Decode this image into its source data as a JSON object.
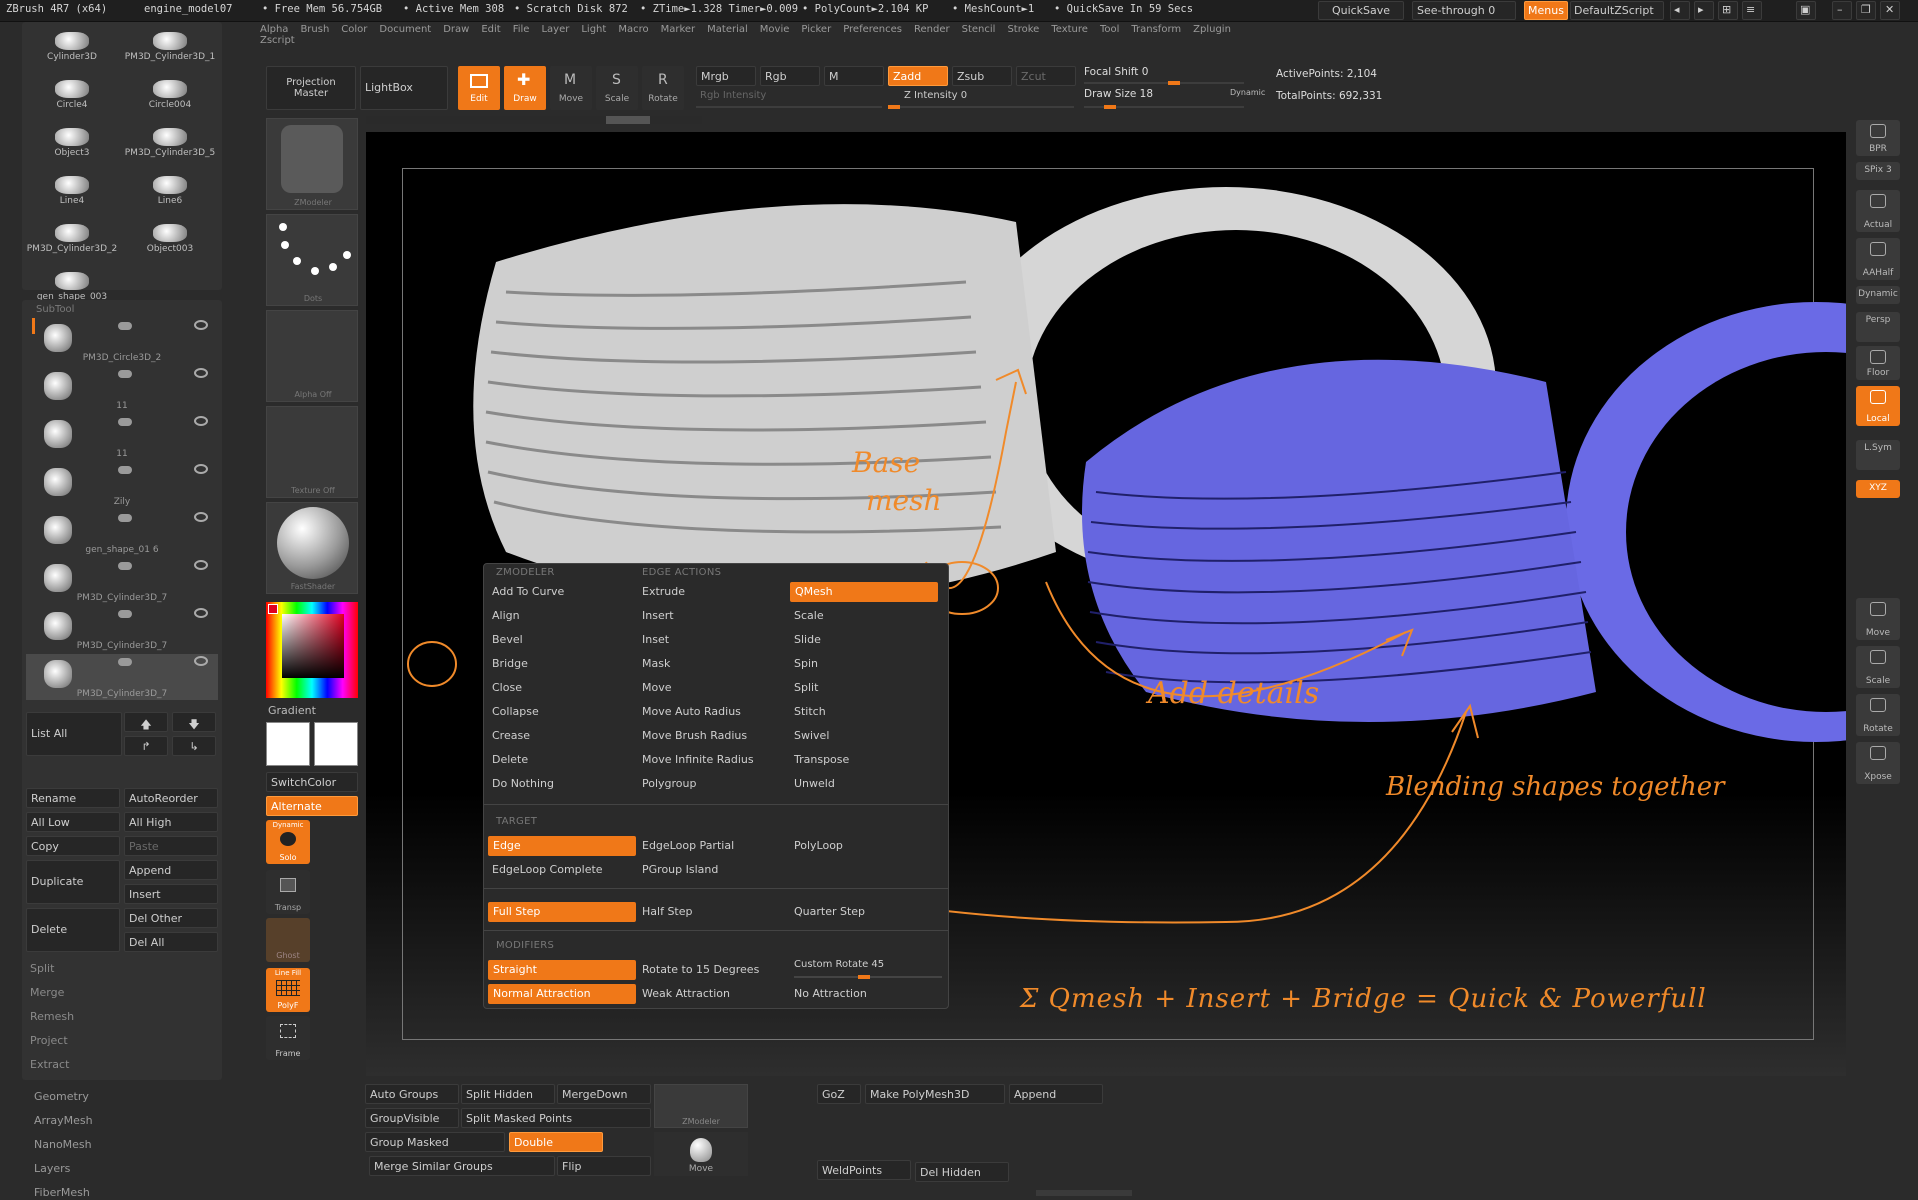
{
  "topbar": {
    "app": "ZBrush 4R7 (x64)",
    "doc": "engine_model07",
    "free_mem": "• Free Mem 56.754GB",
    "active_mem": "• Active Mem 308",
    "scratch": "• Scratch Disk 872",
    "ztime": "• ZTime►1.328 Timer►0.009",
    "polycount": "• PolyCount►2.104 KP",
    "meshcount": "• MeshCount►1",
    "quicksave_in": "• QuickSave In 59 Secs",
    "quicksave": "QuickSave",
    "see_through": "See-through   0",
    "menus": "Menus",
    "script": "DefaultZScript"
  },
  "menubar": [
    "Alpha",
    "Brush",
    "Color",
    "Document",
    "Draw",
    "Edit",
    "File",
    "Layer",
    "Light",
    "Macro",
    "Marker",
    "Material",
    "Movie",
    "Picker",
    "Preferences",
    "Render",
    "Stencil",
    "Stroke",
    "Texture",
    "Tool",
    "Transform",
    "Zplugin",
    "Zscript"
  ],
  "toolbar": {
    "projection_master": "Projection Master",
    "lightbox": "LightBox",
    "edit": "Edit",
    "draw": "Draw",
    "move": "Move",
    "scale": "Scale",
    "rotate": "Rotate",
    "mrgb": "Mrgb",
    "rgb": "Rgb",
    "m": "M",
    "zadd": "Zadd",
    "zsub": "Zsub",
    "zcut": "Zcut",
    "rgb_intensity": "Rgb Intensity",
    "z_intensity": "Z Intensity 0",
    "focal_shift": "Focal Shift 0",
    "draw_size": "Draw Size 18",
    "dynamic": "Dynamic",
    "active_points": "ActivePoints: 2,104",
    "total_points": "TotalPoints: 692,331"
  },
  "tool_grid": [
    {
      "label": "Cylinder3D"
    },
    {
      "label": "PM3D_Cylinder3D_1"
    },
    {
      "label": "Circle4"
    },
    {
      "label": "Circle004"
    },
    {
      "label": "Object3"
    },
    {
      "label": "PM3D_Cylinder3D_5"
    },
    {
      "label": "Line4"
    },
    {
      "label": "Line6"
    },
    {
      "label": "PM3D_Cylinder3D_2"
    },
    {
      "label": "Object003"
    },
    {
      "label": "gen_shape_003"
    }
  ],
  "subtool": {
    "header": "SubTool",
    "items": [
      {
        "label": "PM3D_Circle3D_2"
      },
      {
        "label": "11"
      },
      {
        "label": "11"
      },
      {
        "label": "Zily"
      },
      {
        "label": "gen_shape_01 6"
      },
      {
        "label": "PM3D_Cylinder3D_7"
      },
      {
        "label": "PM3D_Cylinder3D_7"
      },
      {
        "label": "PM3D_Cylinder3D_7"
      }
    ],
    "list_all": "List All",
    "rename": "Rename",
    "autoreorder": "AutoReorder",
    "all_low": "All Low",
    "all_high": "All High",
    "copy": "Copy",
    "paste": "Paste",
    "duplicate": "Duplicate",
    "append": "Append",
    "insert": "Insert",
    "delete": "Delete",
    "del_other": "Del Other",
    "del_all": "Del All",
    "split": "Split",
    "merge": "Merge",
    "remesh": "Remesh",
    "project": "Project",
    "extract": "Extract"
  },
  "left_sections": [
    "Geometry",
    "ArrayMesh",
    "NanoMesh",
    "Layers",
    "FiberMesh"
  ],
  "brush_shelf": {
    "zmodeler": "ZModeler",
    "dots": "Dots",
    "alpha_off": "Alpha  Off",
    "texture_off": "Texture  Off",
    "fastshader": "FastShader",
    "gradient": "Gradient",
    "switchcolor": "SwitchColor",
    "alternate": "Alternate",
    "dynamic": "Dynamic",
    "solo": "Solo",
    "transp": "Transp",
    "ghost": "Ghost",
    "line_fill": "Line Fill",
    "polyf": "PolyF",
    "frame": "Frame"
  },
  "right_shelf": [
    {
      "label": "BPR"
    },
    {
      "label": "SPix 3"
    },
    {
      "label": "Actual"
    },
    {
      "label": "AAHalf"
    },
    {
      "label": "Dynamic"
    },
    {
      "label": "Persp"
    },
    {
      "label": "Floor"
    },
    {
      "label": "Local"
    },
    {
      "label": "L.Sym"
    },
    {
      "label": "XYZ"
    },
    {
      "label": "Move"
    },
    {
      "label": "Scale"
    },
    {
      "label": "Rotate"
    },
    {
      "label": "Xpose"
    }
  ],
  "zmodeler_menu": {
    "h_zmodeler": "ZMODELER",
    "h_edge_actions": "EDGE ACTIONS",
    "col1": [
      "Add To Curve",
      "Align",
      "Bevel",
      "Bridge",
      "Close",
      "Collapse",
      "Crease",
      "Delete",
      "Do Nothing"
    ],
    "col2": [
      "Extrude",
      "Insert",
      "Inset",
      "Mask",
      "Move",
      "Move Auto Radius",
      "Move Brush Radius",
      "Move Infinite Radius",
      "Polygroup"
    ],
    "col3": [
      "QMesh",
      "Scale",
      "Slide",
      "Spin",
      "Split",
      "Stitch",
      "Swivel",
      "Transpose",
      "Unweld"
    ],
    "h_target": "TARGET",
    "target": [
      "Edge",
      "EdgeLoop Partial",
      "PolyLoop",
      "EdgeLoop Complete",
      "PGroup Island"
    ],
    "step": [
      "Full Step",
      "Half Step",
      "Quarter Step"
    ],
    "h_modifiers": "MODIFIERS",
    "modifiers": [
      "Straight",
      "Rotate to 15 Degrees",
      "Custom Rotate 45",
      "Normal Attraction",
      "Weak Attraction",
      "No Attraction"
    ]
  },
  "annotations": {
    "base_mesh_1": "Base",
    "base_mesh_2": "mesh",
    "add_details": "Add details",
    "blending": "Blending shapes together",
    "summary": "Σ Qmesh + Insert + Bridge = Quick & Powerfull"
  },
  "bottom_panel": {
    "auto_groups": "Auto Groups",
    "split_hidden": "Split Hidden",
    "mergedown": "MergeDown",
    "groupvisible": "GroupVisible",
    "split_masked": "Split Masked Points",
    "group_masked": "Group Masked",
    "double": "Double",
    "merge_similar": "Merge Similar Groups",
    "flip": "Flip",
    "zmodeler": "ZModeler",
    "move": "Move",
    "goz": "GoZ",
    "make_polymesh": "Make PolyMesh3D",
    "append": "Append",
    "weldpoints": "WeldPoints",
    "del_hidden": "Del Hidden"
  },
  "colors": {
    "accent": "#f07818",
    "bg": "#2b2b2b",
    "mesh_blue": "#6a6ae6",
    "mesh_grey": "#d9d9d9"
  }
}
